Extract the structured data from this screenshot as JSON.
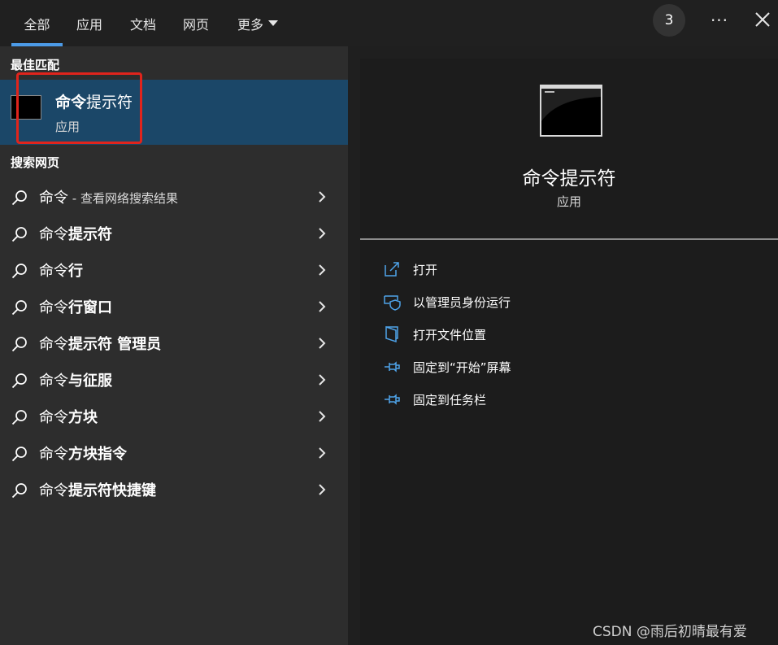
{
  "tabs": [
    {
      "label": "全部",
      "active": true
    },
    {
      "label": "应用",
      "active": false
    },
    {
      "label": "文档",
      "active": false
    },
    {
      "label": "网页",
      "active": false
    },
    {
      "label": "更多",
      "active": false
    }
  ],
  "header": {
    "badge_count": "3",
    "more_options": "···"
  },
  "left": {
    "best_match_title": "最佳匹配",
    "best_match": {
      "name_bold": "命令",
      "name_rest": "提示符",
      "type": "应用",
      "icon": "command-prompt-icon"
    },
    "web_search_title": "搜索网页",
    "web_results": [
      {
        "prefix": "命令",
        "bold": "",
        "suffix": " - 查看网络搜索结果"
      },
      {
        "prefix": "命令",
        "bold": "提示符",
        "suffix": ""
      },
      {
        "prefix": "命令",
        "bold": "行",
        "suffix": ""
      },
      {
        "prefix": "命令",
        "bold": "行窗口",
        "suffix": ""
      },
      {
        "prefix": "命令",
        "bold": "提示符 管理员",
        "suffix": ""
      },
      {
        "prefix": "命令",
        "bold": "与征服",
        "suffix": ""
      },
      {
        "prefix": "命令",
        "bold": "方块",
        "suffix": ""
      },
      {
        "prefix": "命令",
        "bold": "方块指令",
        "suffix": ""
      },
      {
        "prefix": "命令",
        "bold": "提示符快捷键",
        "suffix": ""
      }
    ]
  },
  "right": {
    "title": "命令提示符",
    "subtitle": "应用",
    "actions": [
      {
        "label": "打开",
        "icon": "open-icon"
      },
      {
        "label": "以管理员身份运行",
        "icon": "shield-icon"
      },
      {
        "label": "打开文件位置",
        "icon": "folder-icon"
      },
      {
        "label": "固定到“开始”屏幕",
        "icon": "pin-icon"
      },
      {
        "label": "固定到任务栏",
        "icon": "pin-icon"
      }
    ]
  },
  "watermark": "CSDN @雨后初晴最有爱",
  "colors": {
    "accent": "#4c9be8",
    "selected_row": "#1b4768",
    "highlight_box": "#e0241c"
  }
}
